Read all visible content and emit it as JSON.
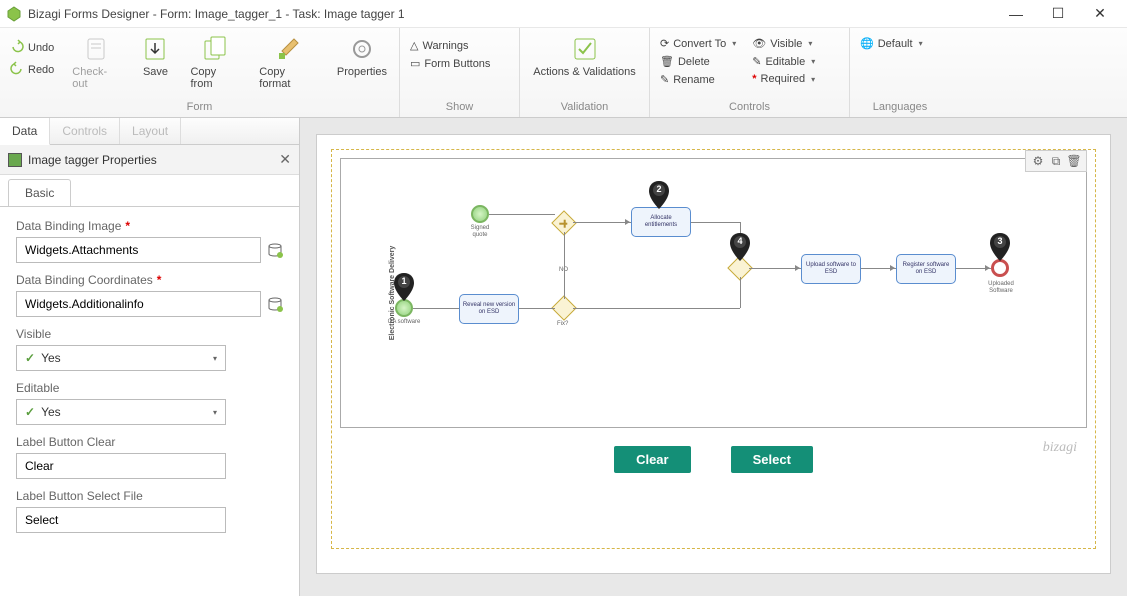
{
  "window": {
    "title": "Bizagi Forms Designer  - Form: Image_tagger_1 - Task:  Image tagger 1",
    "minimize": "—",
    "maximize": "☐",
    "close": "✕"
  },
  "ribbon": {
    "form": {
      "label": "Form",
      "undo": "Undo",
      "redo": "Redo",
      "checkout": "Check-out",
      "save": "Save",
      "copyfrom": "Copy from",
      "copyformat": "Copy format",
      "properties": "Properties"
    },
    "show": {
      "label": "Show",
      "warnings": "Warnings",
      "formbuttons": "Form Buttons"
    },
    "validation": {
      "label": "Validation",
      "actions": "Actions & Validations"
    },
    "controls": {
      "label": "Controls",
      "convert": "Convert To",
      "delete": "Delete",
      "rename": "Rename",
      "visible": "Visible",
      "editable": "Editable",
      "required": "Required"
    },
    "languages": {
      "label": "Languages",
      "default": "Default"
    }
  },
  "sidebar": {
    "tabs": {
      "data": "Data",
      "controls": "Controls",
      "layout": "Layout"
    },
    "header": "Image tagger Properties",
    "proptab": "Basic",
    "fields": {
      "databindimg": {
        "label": "Data Binding Image",
        "value": "Widgets.Attachments"
      },
      "databindcoords": {
        "label": "Data Binding Coordinates",
        "value": "Widgets.Additionalinfo"
      },
      "visible": {
        "label": "Visible",
        "value": "Yes"
      },
      "editable": {
        "label": "Editable",
        "value": "Yes"
      },
      "labelclear": {
        "label": "Label Button Clear",
        "value": "Clear"
      },
      "labelselect": {
        "label": "Label Button Select File",
        "value": "Select"
      }
    }
  },
  "canvas": {
    "clear": "Clear",
    "select": "Select",
    "logo": "bizagi"
  },
  "diagram": {
    "lane": "Electronic Software Delivery",
    "start1": "Signed quote",
    "start2": "GA software",
    "task1": "Reveal new version on ESD",
    "task2": "Allocate entitlements",
    "task3": "Upload software to ESD",
    "task4": "Register software on ESD",
    "end": "Uploaded Software",
    "gate_no": "NO",
    "gate_fix": "Fix?",
    "pins": {
      "p1": "1",
      "p2": "2",
      "p3": "3",
      "p4": "4"
    }
  }
}
